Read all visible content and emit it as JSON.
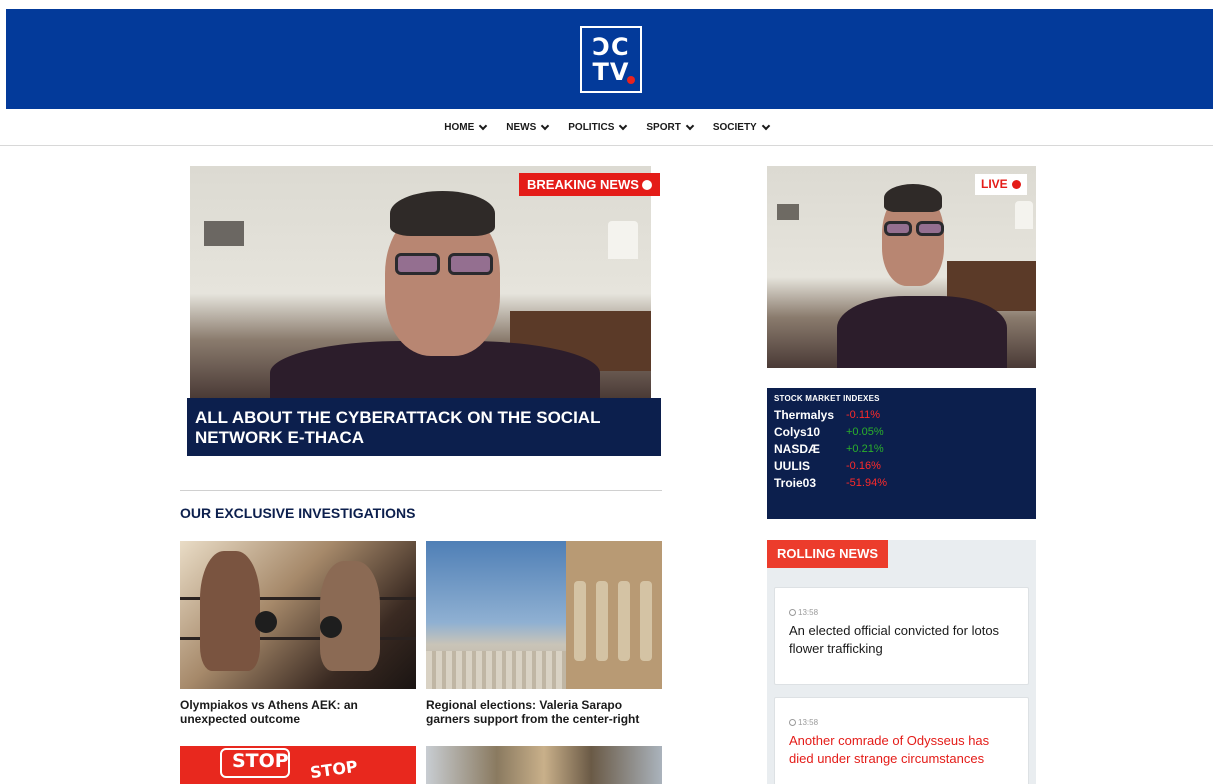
{
  "brand": {
    "logo_line1": "ƆC",
    "logo_line2": "TV",
    "bg": "#033a9a",
    "accent": "#e41c18"
  },
  "nav": {
    "items": [
      {
        "label": "HOME"
      },
      {
        "label": "NEWS"
      },
      {
        "label": "POLITICS"
      },
      {
        "label": "SPORT"
      },
      {
        "label": "SOCIETY"
      }
    ]
  },
  "main": {
    "breaking_badge": "BREAKING NEWS",
    "headline": "ALL ABOUT THE CYBERATTACK ON THE SOCIAL NETWORK E-THACA",
    "section_title": "OUR EXCLUSIVE INVESTIGATIONS",
    "cards": [
      {
        "caption": "Olympiakos vs Athens AEK: an unexpected outcome",
        "image": "boxing-photo"
      },
      {
        "caption": "Regional elections: Valeria Sarapo garners support from the center-right",
        "image": "acropolis-photo"
      },
      {
        "caption": "",
        "image": "stop-signs-photo"
      },
      {
        "caption": "",
        "image": "rope-photo"
      }
    ],
    "stop_text": "STOP"
  },
  "sidebar": {
    "live_badge": "LIVE",
    "stock": {
      "title": "STOCK MARKET INDEXES",
      "rows": [
        {
          "name": "Thermalys",
          "value": "-0.11%",
          "color": "#ff2a2a"
        },
        {
          "name": "Colys10",
          "value": "+0.05%",
          "color": "#2bb02b"
        },
        {
          "name": "NASDÆ",
          "value": "+0.21%",
          "color": "#2bb02b"
        },
        {
          "name": "UULIS",
          "value": "-0.16%",
          "color": "#ff2a2a"
        },
        {
          "name": "Troie03",
          "value": "-51.94%",
          "color": "#ff2a2a"
        }
      ]
    },
    "rolling": {
      "title": "ROLLING NEWS",
      "items": [
        {
          "time": "13:58",
          "text": "An elected official convicted for lotos flower trafficking",
          "highlight": false
        },
        {
          "time": "13:58",
          "text": "Another comrade of Odysseus has died under strange circumstances",
          "highlight": true
        }
      ]
    }
  }
}
